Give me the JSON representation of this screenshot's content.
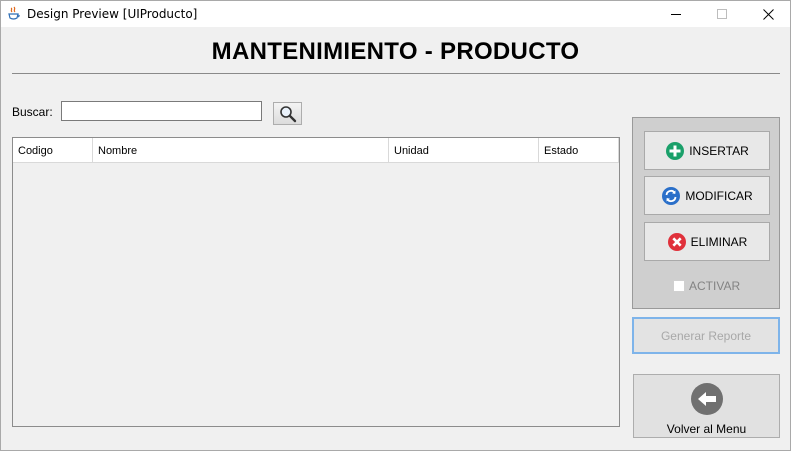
{
  "window": {
    "title": "Design Preview [UIProducto]"
  },
  "header": {
    "title": "MANTENIMIENTO - PRODUCTO"
  },
  "search": {
    "label": "Buscar:",
    "value": "",
    "placeholder": ""
  },
  "table": {
    "columns": [
      "Codigo",
      "Nombre",
      "Unidad",
      "Estado"
    ],
    "rows": []
  },
  "actions": {
    "insert_label": "INSERTAR",
    "modify_label": "MODIFICAR",
    "delete_label": "ELIMINAR",
    "activate_label": "ACTIVAR",
    "activate_checked": false,
    "report_label": "Generar Reporte",
    "back_label": "Volver al Menu"
  },
  "icons": {
    "insert": "plus-circle-icon",
    "modify": "refresh-icon",
    "delete": "x-circle-icon",
    "search": "magnifier-icon",
    "back": "arrow-left-icon"
  },
  "colors": {
    "insert_green": "#1aa06a",
    "modify_blue": "#2a6fc9",
    "delete_red": "#e0313b",
    "focus_border": "#7eb4ea",
    "back_icon_gray": "#707070"
  }
}
